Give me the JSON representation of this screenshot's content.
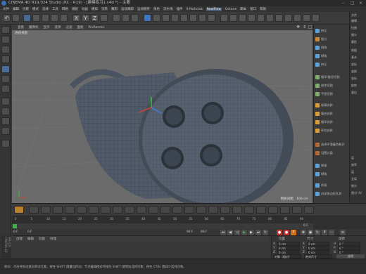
{
  "window": {
    "title": "CINEMA 4D R19.024 Studio (RC - R19) - [建模练习1.c4d *] - 主要"
  },
  "menubar": {
    "items": [
      "文件",
      "编辑",
      "创建",
      "模式",
      "选择",
      "工具",
      "网格",
      "捕捉",
      "动画",
      "模拟",
      "渲染",
      "雕刻",
      "运动跟踪",
      "运动图形",
      "角色",
      "流水线",
      "插件",
      "X-Particles",
      "RealFlow",
      "Octane",
      "脚本",
      "窗口",
      "帮助"
    ],
    "highlight": "RealFlow"
  },
  "toolbar": {
    "axis_x": "X",
    "axis_y": "Y",
    "axis_z": "Z",
    "undo": "↶"
  },
  "viewport": {
    "menu": [
      "查看",
      "摄像机",
      "显示",
      "选项",
      "过滤",
      "面板",
      "ProRender"
    ],
    "label": "透视视图",
    "grid_status": "网格间距：100 cm"
  },
  "attributes": {
    "items": [
      "挤压",
      "细分",
      "倒角",
      "倒角",
      "挤压",
      "循环/路径切割",
      "线性切割",
      "平面切割",
      "轮廓选择",
      "填充选择",
      "循环选择",
      "环状选择",
      "选择平滑着色断开",
      "设置点值",
      "焊接",
      "倒角",
      "桥接",
      "封闭多边形孔洞"
    ]
  },
  "objects": {
    "items": [
      "文件",
      "编辑",
      "扭曲",
      "细分",
      "圆柱",
      "根据",
      "基本",
      "坐标",
      "变换",
      "坐标",
      "旋转",
      "量比",
      "层",
      "曲率",
      "层",
      "全局",
      "细分",
      "细分 UV"
    ]
  },
  "timeline": {
    "ticks": [
      "0",
      "5",
      "10",
      "15",
      "20",
      "25",
      "30",
      "35",
      "40",
      "45",
      "50",
      "55",
      "60",
      "65",
      "70",
      "75",
      "80",
      "85",
      "90"
    ],
    "end_label": "0 F",
    "start_frame": "0 F",
    "frame_field": "0 F",
    "end_frame": "90 F",
    "end_frame2": "90 F"
  },
  "materials": {
    "tabs": [
      "创建",
      "编辑",
      "功能",
      "纹理"
    ]
  },
  "coords": {
    "headers": [
      "位置",
      "尺寸",
      "旋转"
    ],
    "rows": [
      {
        "axis": "X",
        "pos": "0 cm",
        "size": "0 cm",
        "rot_label": "H",
        "rot": "0 °"
      },
      {
        "axis": "Y",
        "pos": "0 cm",
        "size": "0 cm",
        "rot_label": "P",
        "rot": "0 °"
      },
      {
        "axis": "Z",
        "pos": "0 cm",
        "size": "0 cm",
        "rot_label": "B",
        "rot": "0 °"
      }
    ],
    "mode": "对象（相对）",
    "size_mode": "绝对尺寸",
    "apply": "应用"
  },
  "brand": {
    "maxon": "MAXON CINEMA 4D"
  },
  "status": {
    "text": "移动：点击并拖动鼠标移动元素。按住 SHIFT 键量化移动；节点编辑模式时按住 SHIFT 键增加选择对象；按住 CTRL 键减少选择对象。"
  }
}
